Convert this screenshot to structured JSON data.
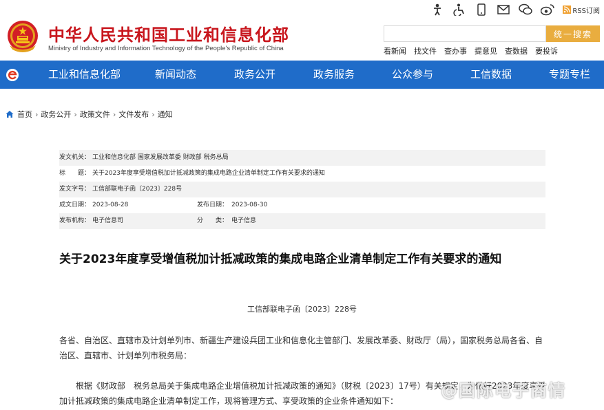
{
  "header": {
    "title": "中华人民共和国工业和信息化部",
    "subtitle": "Ministry of Industry and Information Technology of the People's Republic of China",
    "utility_icons": [
      "elder-mode-icon",
      "accessibility-icon",
      "mobile-icon",
      "mail-icon",
      "wechat-icon",
      "weibo-icon",
      "rss-icon"
    ],
    "rss_label": "RSS订阅",
    "search": {
      "placeholder": "",
      "button_label": "统一搜索"
    },
    "quick_links": [
      "看新闻",
      "找文件",
      "查办事",
      "提意见",
      "查数据",
      "要投诉"
    ]
  },
  "nav": {
    "items": [
      "工业和信息化部",
      "新闻动态",
      "政务公开",
      "政务服务",
      "公众参与",
      "工信数据",
      "专题专栏"
    ]
  },
  "breadcrumb": [
    "首页",
    "政务公开",
    "政策文件",
    "文件发布",
    "通知"
  ],
  "meta": {
    "issuer_label": "发文机关：",
    "issuer": "工业和信息化部 国家发展改革委 财政部 税务总局",
    "title_label": "标　　题：",
    "title": "关于2023年度享受增值税加计抵减政策的集成电路企业清单制定工作有关要求的通知",
    "docno_label": "发文字号：",
    "docno": "工信部联电子函〔2023〕228号",
    "written_label": "成文日期：",
    "written": "2023-08-28",
    "published_label": "发布日期：",
    "published": "2023-08-30",
    "org_label": "发布机构：",
    "org": "电子信息司",
    "category_label": "分　　类：",
    "category": "电子信息"
  },
  "article": {
    "title": "关于2023年度享受增值税加计抵减政策的集成电路企业清单制定工作有关要求的通知",
    "doc_number": "工信部联电子函〔2023〕228号",
    "para1": "各省、自治区、直辖市及计划单列市、新疆生产建设兵团工业和信息化主管部门、发展改革委、财政厅（局），国家税务总局各省、自治区、直辖市、计划单列市税务局：",
    "para2": "根据《财政部　税务总局关于集成电路企业增值税加计抵减政策的通知》（财税〔2023〕17号）有关规定，为做好2023年度享受加计抵减政策的集成电路企业清单制定工作，现将管理方式、享受政策的企业条件通知如下："
  },
  "watermark": "@国际电子商情",
  "colors": {
    "brand_red": "#c8161d",
    "nav_blue": "#1f6cc9",
    "search_button": "#e9ad3f",
    "meta_shade": "#f2f2f2"
  }
}
